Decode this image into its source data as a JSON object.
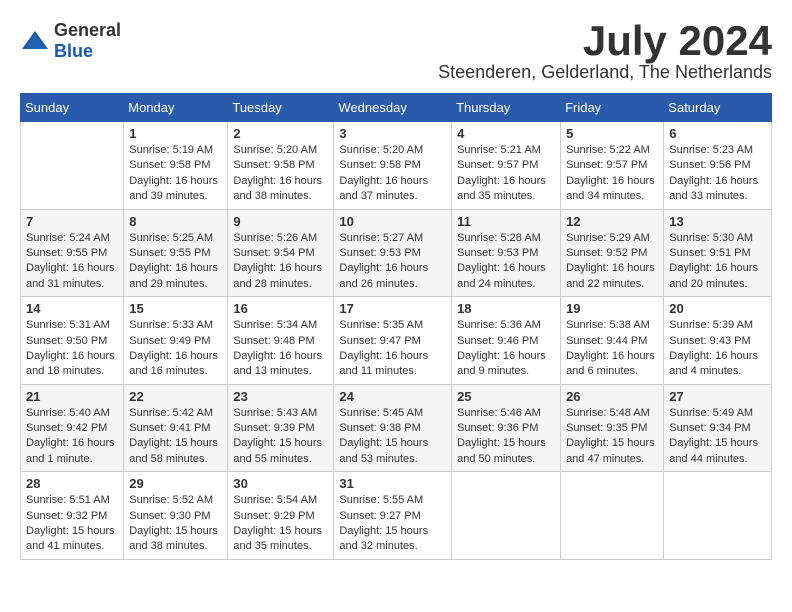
{
  "logo": {
    "general": "General",
    "blue": "Blue"
  },
  "title": {
    "month_year": "July 2024",
    "location": "Steenderen, Gelderland, The Netherlands"
  },
  "headers": [
    "Sunday",
    "Monday",
    "Tuesday",
    "Wednesday",
    "Thursday",
    "Friday",
    "Saturday"
  ],
  "weeks": [
    [
      {
        "day": "",
        "info": ""
      },
      {
        "day": "1",
        "info": "Sunrise: 5:19 AM\nSunset: 9:58 PM\nDaylight: 16 hours and 39 minutes."
      },
      {
        "day": "2",
        "info": "Sunrise: 5:20 AM\nSunset: 9:58 PM\nDaylight: 16 hours and 38 minutes."
      },
      {
        "day": "3",
        "info": "Sunrise: 5:20 AM\nSunset: 9:58 PM\nDaylight: 16 hours and 37 minutes."
      },
      {
        "day": "4",
        "info": "Sunrise: 5:21 AM\nSunset: 9:57 PM\nDaylight: 16 hours and 35 minutes."
      },
      {
        "day": "5",
        "info": "Sunrise: 5:22 AM\nSunset: 9:57 PM\nDaylight: 16 hours and 34 minutes."
      },
      {
        "day": "6",
        "info": "Sunrise: 5:23 AM\nSunset: 9:56 PM\nDaylight: 16 hours and 33 minutes."
      }
    ],
    [
      {
        "day": "7",
        "info": "Sunrise: 5:24 AM\nSunset: 9:55 PM\nDaylight: 16 hours and 31 minutes."
      },
      {
        "day": "8",
        "info": "Sunrise: 5:25 AM\nSunset: 9:55 PM\nDaylight: 16 hours and 29 minutes."
      },
      {
        "day": "9",
        "info": "Sunrise: 5:26 AM\nSunset: 9:54 PM\nDaylight: 16 hours and 28 minutes."
      },
      {
        "day": "10",
        "info": "Sunrise: 5:27 AM\nSunset: 9:53 PM\nDaylight: 16 hours and 26 minutes."
      },
      {
        "day": "11",
        "info": "Sunrise: 5:28 AM\nSunset: 9:53 PM\nDaylight: 16 hours and 24 minutes."
      },
      {
        "day": "12",
        "info": "Sunrise: 5:29 AM\nSunset: 9:52 PM\nDaylight: 16 hours and 22 minutes."
      },
      {
        "day": "13",
        "info": "Sunrise: 5:30 AM\nSunset: 9:51 PM\nDaylight: 16 hours and 20 minutes."
      }
    ],
    [
      {
        "day": "14",
        "info": "Sunrise: 5:31 AM\nSunset: 9:50 PM\nDaylight: 16 hours and 18 minutes."
      },
      {
        "day": "15",
        "info": "Sunrise: 5:33 AM\nSunset: 9:49 PM\nDaylight: 16 hours and 16 minutes."
      },
      {
        "day": "16",
        "info": "Sunrise: 5:34 AM\nSunset: 9:48 PM\nDaylight: 16 hours and 13 minutes."
      },
      {
        "day": "17",
        "info": "Sunrise: 5:35 AM\nSunset: 9:47 PM\nDaylight: 16 hours and 11 minutes."
      },
      {
        "day": "18",
        "info": "Sunrise: 5:36 AM\nSunset: 9:46 PM\nDaylight: 16 hours and 9 minutes."
      },
      {
        "day": "19",
        "info": "Sunrise: 5:38 AM\nSunset: 9:44 PM\nDaylight: 16 hours and 6 minutes."
      },
      {
        "day": "20",
        "info": "Sunrise: 5:39 AM\nSunset: 9:43 PM\nDaylight: 16 hours and 4 minutes."
      }
    ],
    [
      {
        "day": "21",
        "info": "Sunrise: 5:40 AM\nSunset: 9:42 PM\nDaylight: 16 hours and 1 minute."
      },
      {
        "day": "22",
        "info": "Sunrise: 5:42 AM\nSunset: 9:41 PM\nDaylight: 15 hours and 58 minutes."
      },
      {
        "day": "23",
        "info": "Sunrise: 5:43 AM\nSunset: 9:39 PM\nDaylight: 15 hours and 55 minutes."
      },
      {
        "day": "24",
        "info": "Sunrise: 5:45 AM\nSunset: 9:38 PM\nDaylight: 15 hours and 53 minutes."
      },
      {
        "day": "25",
        "info": "Sunrise: 5:46 AM\nSunset: 9:36 PM\nDaylight: 15 hours and 50 minutes."
      },
      {
        "day": "26",
        "info": "Sunrise: 5:48 AM\nSunset: 9:35 PM\nDaylight: 15 hours and 47 minutes."
      },
      {
        "day": "27",
        "info": "Sunrise: 5:49 AM\nSunset: 9:34 PM\nDaylight: 15 hours and 44 minutes."
      }
    ],
    [
      {
        "day": "28",
        "info": "Sunrise: 5:51 AM\nSunset: 9:32 PM\nDaylight: 15 hours and 41 minutes."
      },
      {
        "day": "29",
        "info": "Sunrise: 5:52 AM\nSunset: 9:30 PM\nDaylight: 15 hours and 38 minutes."
      },
      {
        "day": "30",
        "info": "Sunrise: 5:54 AM\nSunset: 9:29 PM\nDaylight: 15 hours and 35 minutes."
      },
      {
        "day": "31",
        "info": "Sunrise: 5:55 AM\nSunset: 9:27 PM\nDaylight: 15 hours and 32 minutes."
      },
      {
        "day": "",
        "info": ""
      },
      {
        "day": "",
        "info": ""
      },
      {
        "day": "",
        "info": ""
      }
    ]
  ]
}
